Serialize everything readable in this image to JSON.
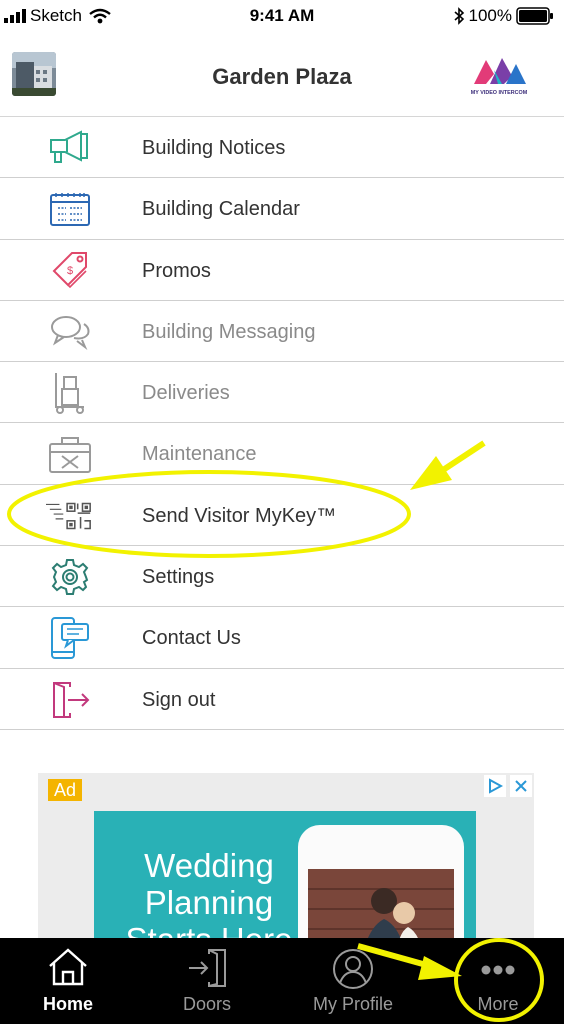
{
  "status_bar": {
    "carrier": "Sketch",
    "time": "9:41 AM",
    "battery": "100%"
  },
  "header": {
    "title": "Garden Plaza",
    "logo_text": "MY VIDEO INTERCOM"
  },
  "menu": [
    {
      "label": "Building Notices",
      "icon": "megaphone-icon"
    },
    {
      "label": "Building Calendar",
      "icon": "calendar-icon"
    },
    {
      "label": "Promos",
      "icon": "price-tag-icon"
    },
    {
      "label": "Building Messaging",
      "icon": "chat-bubbles-icon"
    },
    {
      "label": "Deliveries",
      "icon": "hand-truck-icon"
    },
    {
      "label": "Maintenance",
      "icon": "toolbox-icon"
    },
    {
      "label": "Send Visitor MyKey™",
      "icon": "qr-code-icon"
    },
    {
      "label": "Settings",
      "icon": "gear-icon"
    },
    {
      "label": "Contact Us",
      "icon": "phone-message-icon"
    },
    {
      "label": "Sign out",
      "icon": "sign-out-icon"
    }
  ],
  "ad": {
    "badge": "Ad",
    "line1": "Wedding",
    "line2": "Planning",
    "line3": "Starts Here"
  },
  "tabs": [
    {
      "label": "Home",
      "icon": "home-icon",
      "active": true
    },
    {
      "label": "Doors",
      "icon": "door-icon",
      "active": false
    },
    {
      "label": "My Profile",
      "icon": "profile-icon",
      "active": false
    },
    {
      "label": "More",
      "icon": "more-dots-icon",
      "active": false
    }
  ],
  "colors": {
    "highlight": "#f2f200",
    "tab_bg": "#000000",
    "ad_teal": "#29b1b6"
  }
}
